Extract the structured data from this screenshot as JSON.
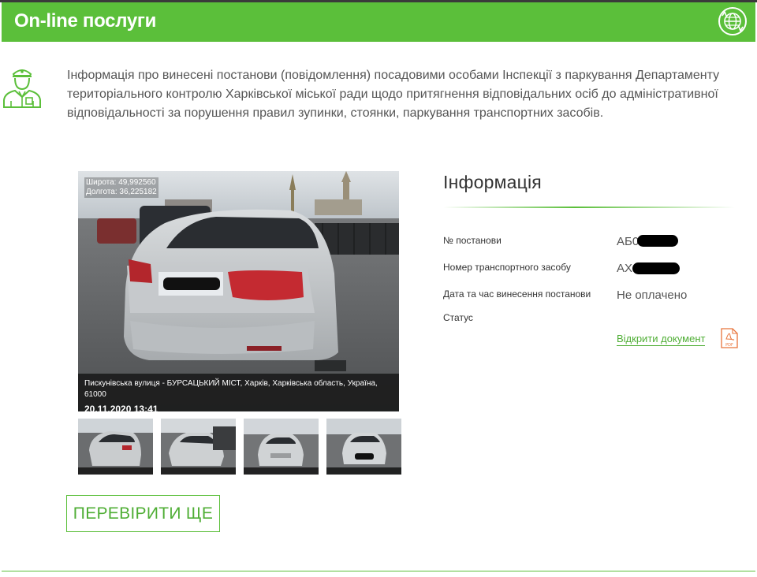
{
  "header": {
    "title": "On-line послуги",
    "icon": "globe-refresh-icon"
  },
  "intro": {
    "icon": "parking-inspector-icon",
    "text": "Інформація про винесені постанови (повідомлення) посадовими особами Інспекції з паркування Департаменту територіального контролю Харківської міської ради щодо притягнення відповідальних осіб до адміністративної відповідальності за порушення правил зупинки, стоянки, паркування транспортних засобів."
  },
  "photo": {
    "latitude": "Широта: 49,992560",
    "longitude": "Долгота: 36,225182",
    "address": "Пискунівська вулиця - БУРСАЦЬКИЙ МІСТ, Харків, Харківська область, Україна, 61000",
    "datetime": "20.11.2020 13:41"
  },
  "thumbnails_count": 4,
  "check_again_button": "ПЕРЕВІРИТИ ЩЕ",
  "info": {
    "title": "Інформація",
    "fields": [
      {
        "label": "№ постанови",
        "value": "АБ0"
      },
      {
        "label": "Номер транспортного засобу",
        "value": "АХ"
      },
      {
        "label": "Дата та час винесення постанови",
        "value": "Не оплачено"
      },
      {
        "label": "Статус",
        "value": ""
      }
    ],
    "document_link": "Відкрити документ",
    "pdf_icon_text": "PDF"
  },
  "colors": {
    "brand_green": "#5bbf3a",
    "header_text": "#ffffff"
  }
}
